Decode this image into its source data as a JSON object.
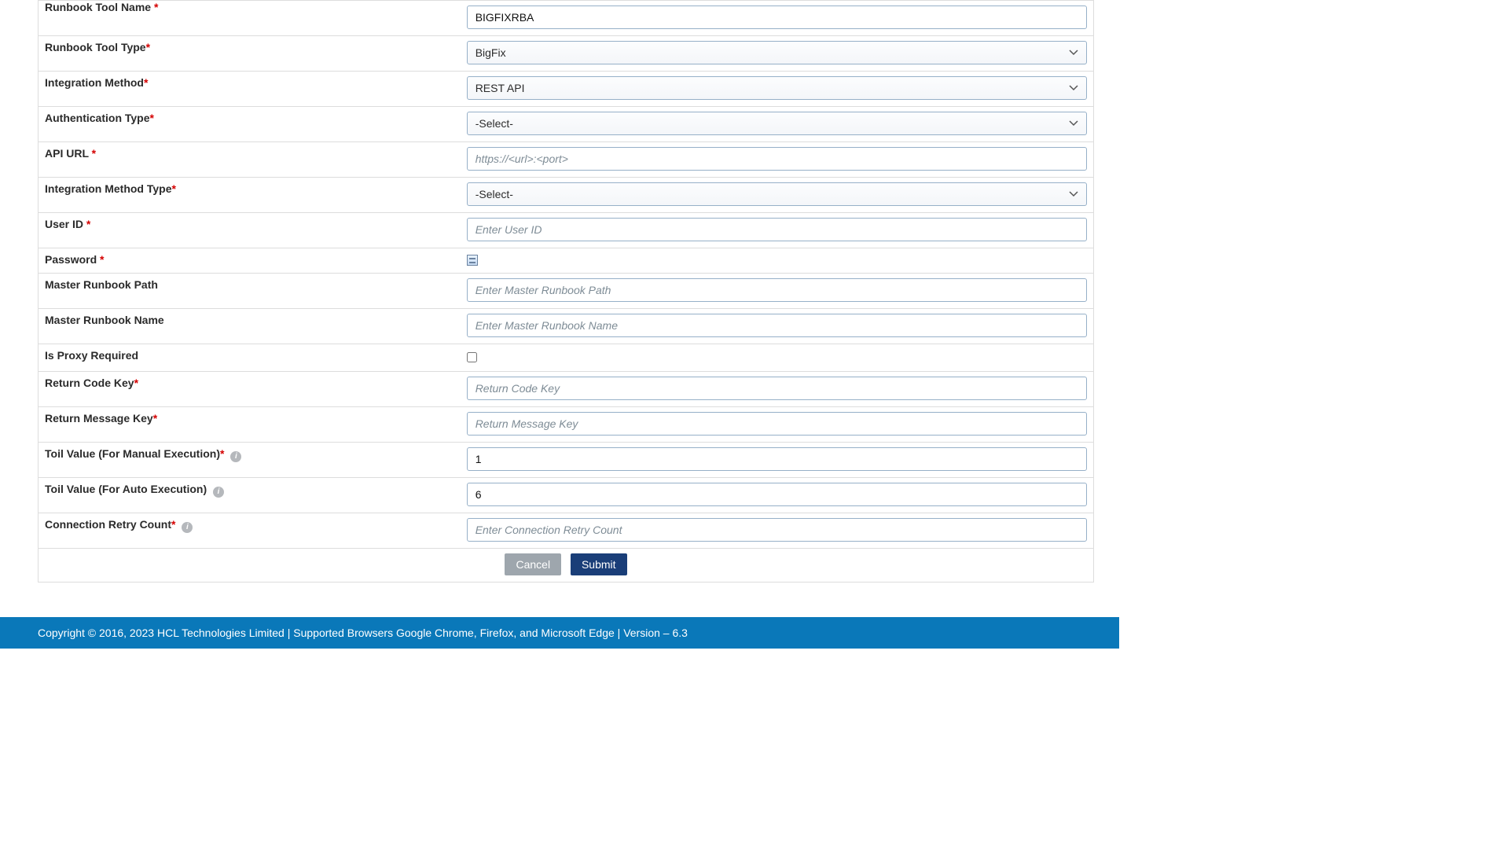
{
  "form": {
    "tool_name": {
      "label": "Runbook Tool Name",
      "required": true,
      "value": "BIGFIXRBA"
    },
    "tool_type": {
      "label": "Runbook Tool Type",
      "required": true,
      "value": "BigFix"
    },
    "integration_method": {
      "label": "Integration Method",
      "required": true,
      "value": "REST API"
    },
    "auth_type": {
      "label": "Authentication Type",
      "required": true,
      "value": "-Select-"
    },
    "api_url": {
      "label": "API URL",
      "required": true,
      "placeholder": "https://<url>:<port>",
      "value": ""
    },
    "integration_method_type": {
      "label": "Integration Method Type",
      "required": true,
      "value": "-Select-"
    },
    "user_id": {
      "label": "User ID",
      "required": true,
      "placeholder": "Enter User ID",
      "value": ""
    },
    "password": {
      "label": "Password",
      "required": true
    },
    "master_path": {
      "label": "Master Runbook Path",
      "required": false,
      "placeholder": "Enter Master Runbook Path",
      "value": ""
    },
    "master_name": {
      "label": "Master Runbook Name",
      "required": false,
      "placeholder": "Enter Master Runbook Name",
      "value": ""
    },
    "proxy": {
      "label": "Is Proxy Required",
      "required": false,
      "checked": false
    },
    "return_code": {
      "label": "Return Code Key",
      "required": true,
      "placeholder": "Return Code Key",
      "value": ""
    },
    "return_msg": {
      "label": "Return Message Key",
      "required": true,
      "placeholder": "Return Message Key",
      "value": ""
    },
    "toil_manual": {
      "label": "Toil Value (For Manual Execution)",
      "required": true,
      "info": true,
      "value": "1"
    },
    "toil_auto": {
      "label": "Toil Value (For Auto Execution)",
      "required": false,
      "info": true,
      "value": "6"
    },
    "retry": {
      "label": "Connection Retry Count",
      "required": true,
      "info": true,
      "placeholder": "Enter Connection Retry Count",
      "value": ""
    }
  },
  "buttons": {
    "cancel": "Cancel",
    "submit": "Submit"
  },
  "footer": "Copyright © 2016, 2023 HCL Technologies Limited | Supported Browsers Google Chrome, Firefox, and Microsoft Edge | Version – 6.3"
}
